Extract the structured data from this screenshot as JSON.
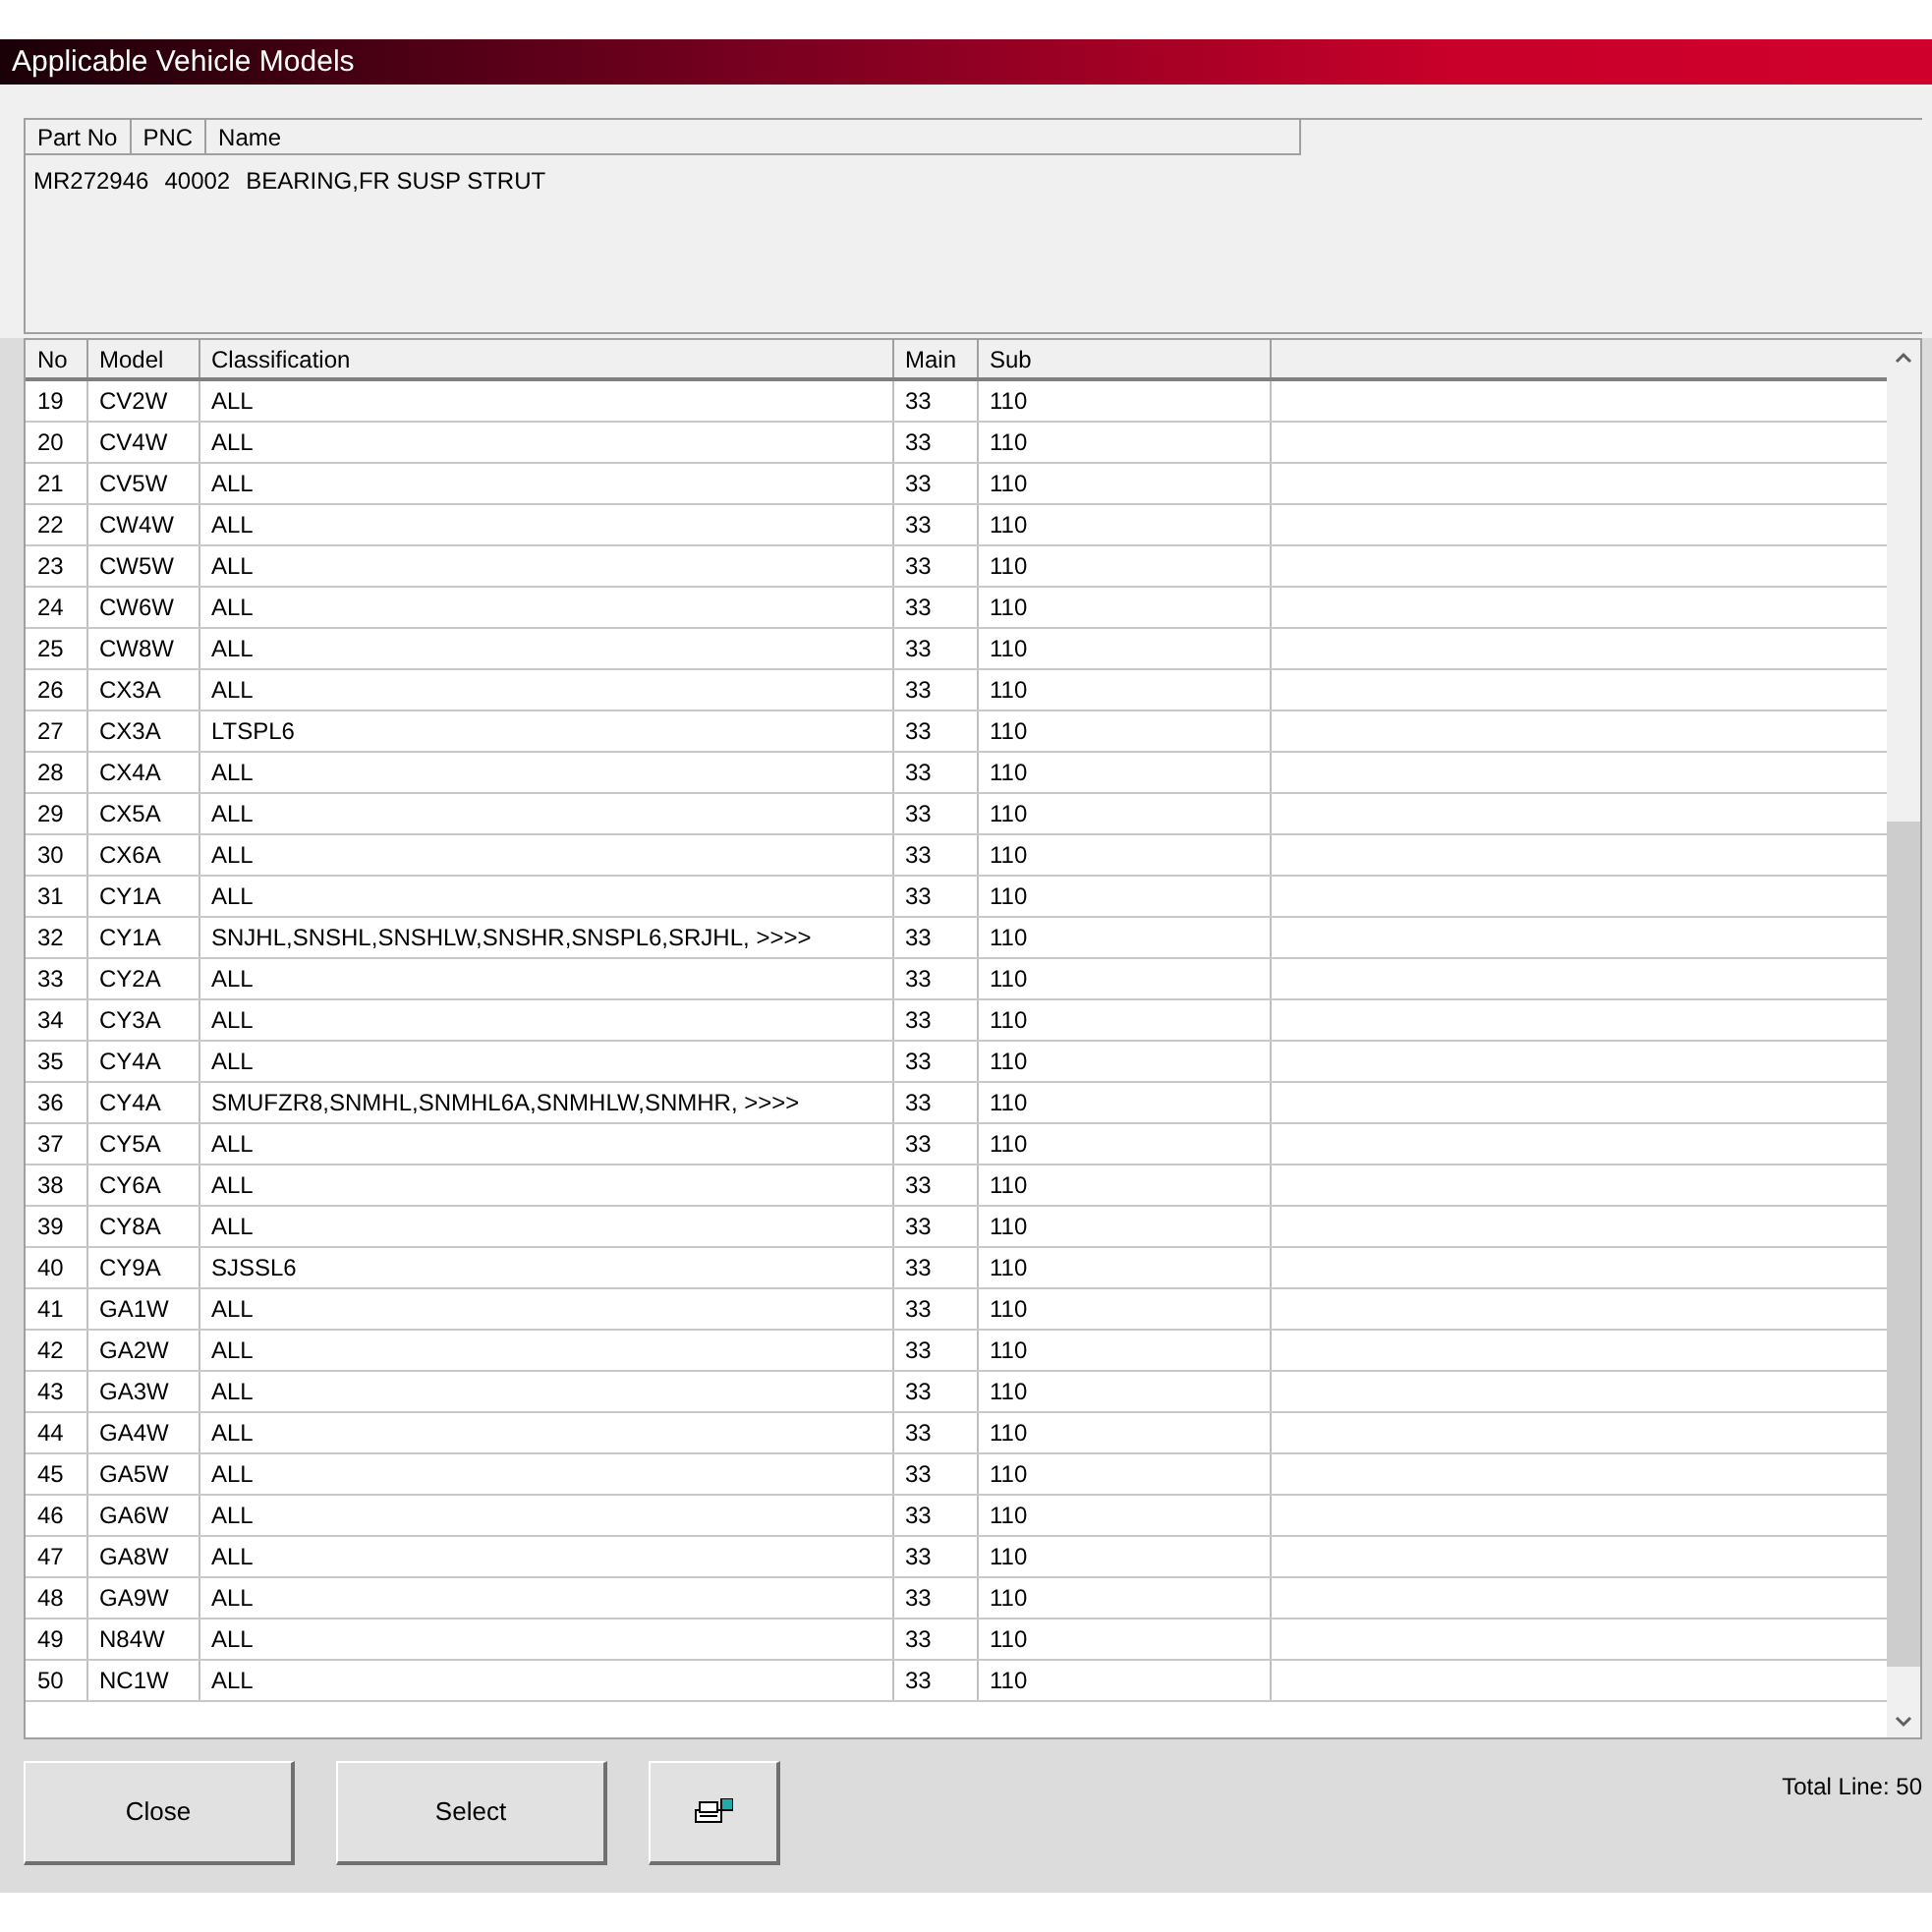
{
  "window": {
    "title": "Applicable Vehicle Models"
  },
  "part": {
    "columns": [
      "Part No",
      "PNC",
      "Name"
    ],
    "row": [
      "MR272946",
      "40002",
      "BEARING,FR SUSP STRUT"
    ]
  },
  "table": {
    "columns": [
      "No",
      "Model",
      "Classification",
      "Main",
      "Sub"
    ],
    "rows": [
      [
        "19",
        "CV2W",
        "ALL",
        "33",
        "110"
      ],
      [
        "20",
        "CV4W",
        "ALL",
        "33",
        "110"
      ],
      [
        "21",
        "CV5W",
        "ALL",
        "33",
        "110"
      ],
      [
        "22",
        "CW4W",
        "ALL",
        "33",
        "110"
      ],
      [
        "23",
        "CW5W",
        "ALL",
        "33",
        "110"
      ],
      [
        "24",
        "CW6W",
        "ALL",
        "33",
        "110"
      ],
      [
        "25",
        "CW8W",
        "ALL",
        "33",
        "110"
      ],
      [
        "26",
        "CX3A",
        "ALL",
        "33",
        "110"
      ],
      [
        "27",
        "CX3A",
        "LTSPL6",
        "33",
        "110"
      ],
      [
        "28",
        "CX4A",
        "ALL",
        "33",
        "110"
      ],
      [
        "29",
        "CX5A",
        "ALL",
        "33",
        "110"
      ],
      [
        "30",
        "CX6A",
        "ALL",
        "33",
        "110"
      ],
      [
        "31",
        "CY1A",
        "ALL",
        "33",
        "110"
      ],
      [
        "32",
        "CY1A",
        "SNJHL,SNSHL,SNSHLW,SNSHR,SNSPL6,SRJHL,  >>>>",
        "33",
        "110"
      ],
      [
        "33",
        "CY2A",
        "ALL",
        "33",
        "110"
      ],
      [
        "34",
        "CY3A",
        "ALL",
        "33",
        "110"
      ],
      [
        "35",
        "CY4A",
        "ALL",
        "33",
        "110"
      ],
      [
        "36",
        "CY4A",
        "SMUFZR8,SNMHL,SNMHL6A,SNMHLW,SNMHR,  >>>>",
        "33",
        "110"
      ],
      [
        "37",
        "CY5A",
        "ALL",
        "33",
        "110"
      ],
      [
        "38",
        "CY6A",
        "ALL",
        "33",
        "110"
      ],
      [
        "39",
        "CY8A",
        "ALL",
        "33",
        "110"
      ],
      [
        "40",
        "CY9A",
        "SJSSL6",
        "33",
        "110"
      ],
      [
        "41",
        "GA1W",
        "ALL",
        "33",
        "110"
      ],
      [
        "42",
        "GA2W",
        "ALL",
        "33",
        "110"
      ],
      [
        "43",
        "GA3W",
        "ALL",
        "33",
        "110"
      ],
      [
        "44",
        "GA4W",
        "ALL",
        "33",
        "110"
      ],
      [
        "45",
        "GA5W",
        "ALL",
        "33",
        "110"
      ],
      [
        "46",
        "GA6W",
        "ALL",
        "33",
        "110"
      ],
      [
        "47",
        "GA8W",
        "ALL",
        "33",
        "110"
      ],
      [
        "48",
        "GA9W",
        "ALL",
        "33",
        "110"
      ],
      [
        "49",
        "N84W",
        "ALL",
        "33",
        "110"
      ],
      [
        "50",
        "NC1W",
        "ALL",
        "33",
        "110"
      ]
    ]
  },
  "buttons": [
    {
      "kind": "text",
      "label": "Close"
    },
    {
      "kind": "text",
      "label": "Select"
    },
    {
      "kind": "print"
    }
  ],
  "status": "Total Line: 50"
}
